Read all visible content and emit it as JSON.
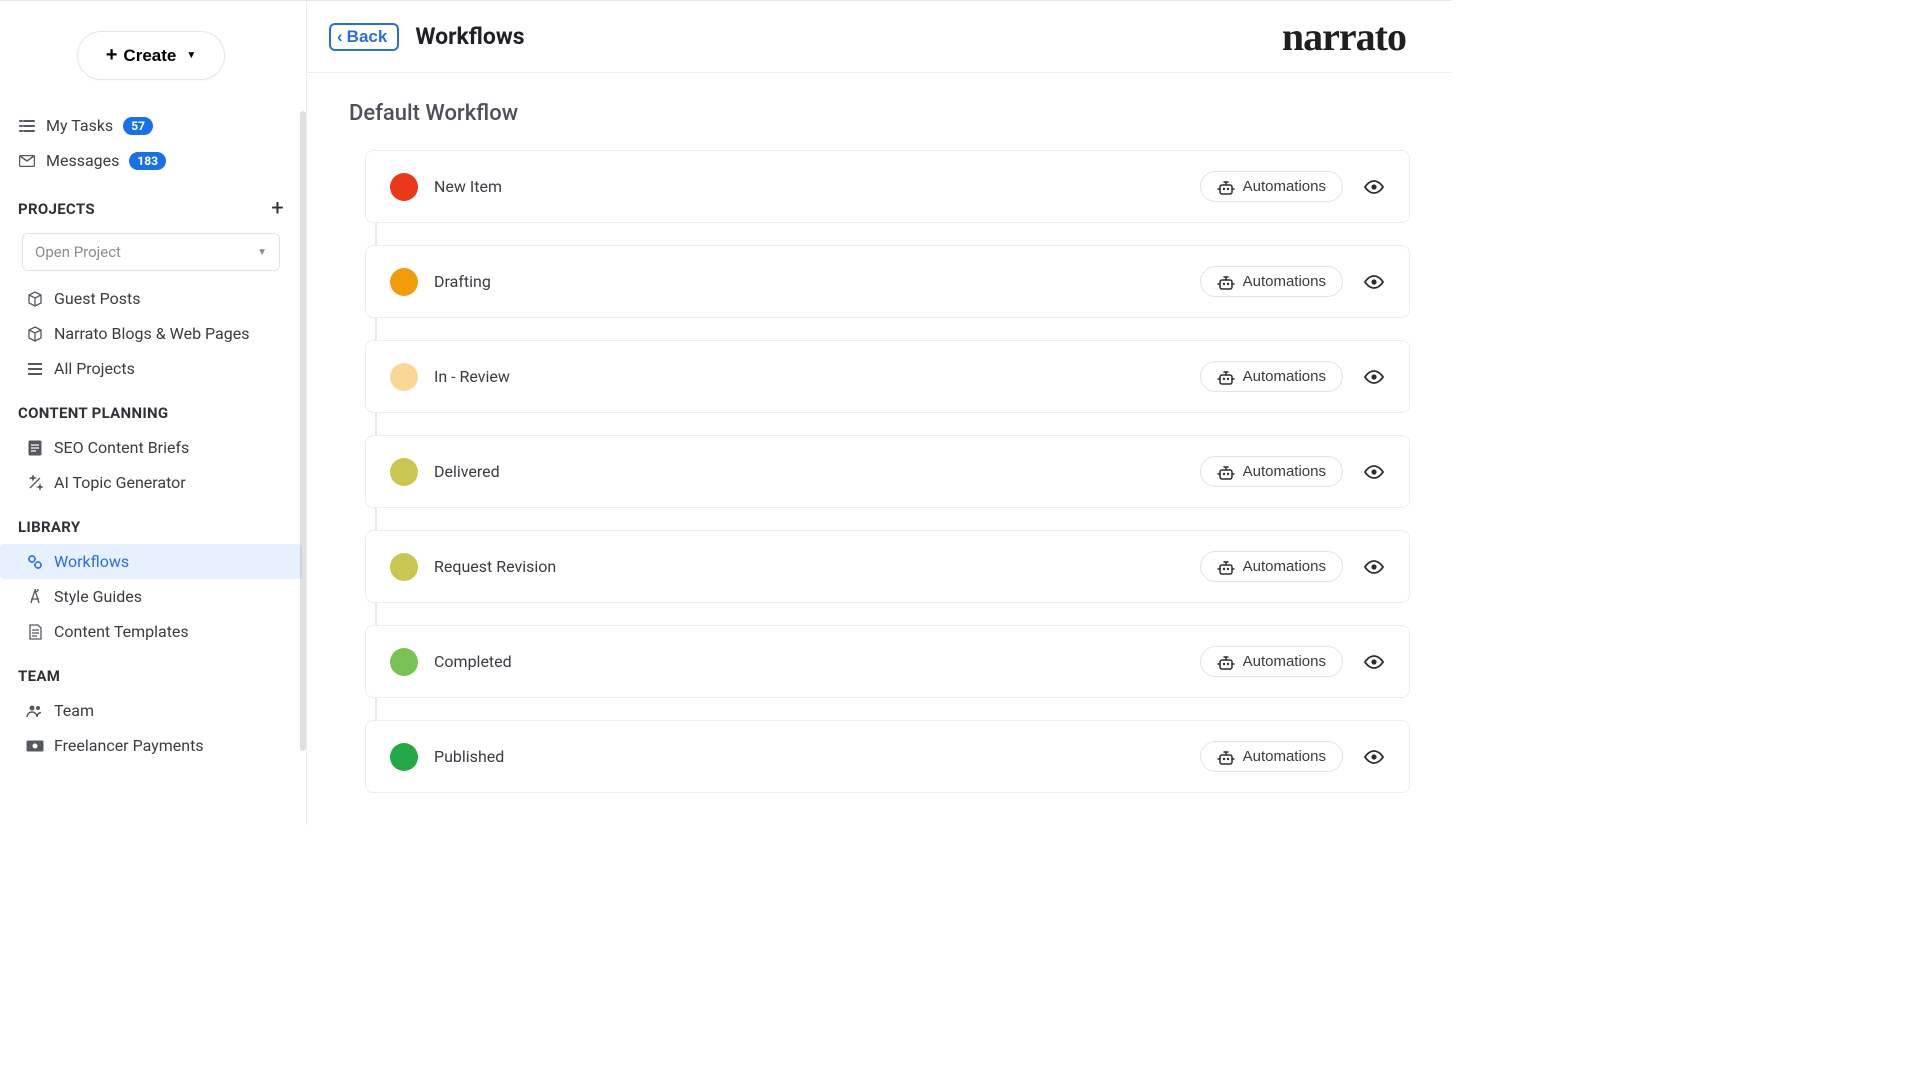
{
  "brand": "narrato",
  "header": {
    "back_label": "Back",
    "title": "Workflows"
  },
  "sidebar": {
    "create_label": "Create",
    "my_tasks_label": "My Tasks",
    "my_tasks_count": "57",
    "messages_label": "Messages",
    "messages_count": "183",
    "projects_header": "PROJECTS",
    "open_project_label": "Open Project",
    "projects": [
      {
        "label": "Guest Posts"
      },
      {
        "label": "Narrato Blogs & Web Pages"
      },
      {
        "label": "All Projects"
      }
    ],
    "content_planning_header": "CONTENT PLANNING",
    "seo_briefs_label": "SEO Content Briefs",
    "ai_topic_label": "AI Topic Generator",
    "library_header": "LIBRARY",
    "workflows_label": "Workflows",
    "style_guides_label": "Style Guides",
    "content_templates_label": "Content Templates",
    "team_header": "TEAM",
    "team_label": "Team",
    "freelancer_payments_label": "Freelancer Payments"
  },
  "workflow": {
    "name": "Default Workflow",
    "automations_label": "Automations",
    "stages": [
      {
        "name": "New Item",
        "color": "#e83a1b"
      },
      {
        "name": "Drafting",
        "color": "#f09c0d"
      },
      {
        "name": "In - Review",
        "color": "#f9d796"
      },
      {
        "name": "Delivered",
        "color": "#c9c651"
      },
      {
        "name": "Request Revision",
        "color": "#c9c651"
      },
      {
        "name": "Completed",
        "color": "#78c152"
      },
      {
        "name": "Published",
        "color": "#23a947"
      }
    ]
  }
}
